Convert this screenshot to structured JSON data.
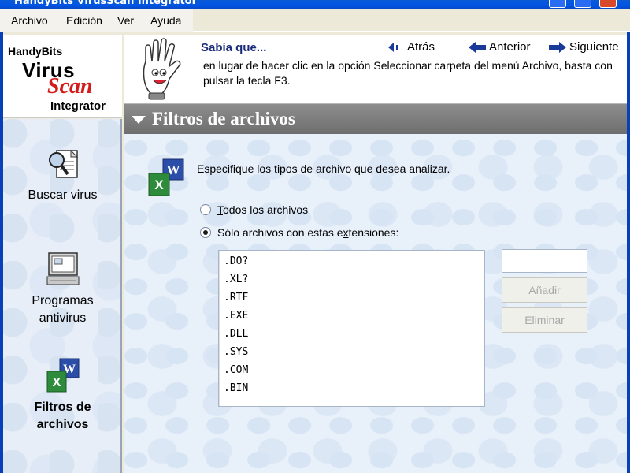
{
  "window": {
    "title": "HandyBits VirusScan Integrator"
  },
  "menu": [
    "Archivo",
    "Edición",
    "Ver",
    "Ayuda"
  ],
  "logo": {
    "line1": "HandyBits",
    "line2": "Virus",
    "line3": "Scan",
    "line4": "Integrator"
  },
  "sidebar": {
    "items": [
      {
        "label_lines": [
          "Buscar virus"
        ],
        "icon": "magnifier-document-icon",
        "active": false
      },
      {
        "label_lines": [
          "Programas",
          "antivirus"
        ],
        "icon": "computer-icon",
        "active": false
      },
      {
        "label_lines": [
          "Filtros de",
          "archivos"
        ],
        "icon": "word-excel-icon",
        "active": true
      }
    ]
  },
  "tip": {
    "heading": "Sabía que...",
    "text": "en lugar de hacer clic en la opción Seleccionar carpeta del menú Archivo, basta con pulsar la tecla F3.",
    "nav": {
      "back": "Atrás",
      "prev": "Anterior",
      "next": "Siguiente"
    }
  },
  "section": {
    "title": "Filtros de archivos"
  },
  "content": {
    "description": "Especifique los tipos de archivo que desea analizar.",
    "options": [
      {
        "label": "Todos los archivos",
        "mnemonic": "T",
        "checked": false
      },
      {
        "label": "Sólo archivos con estas extensiones:",
        "mnemonic": "x",
        "checked": true
      }
    ],
    "extensions": [
      ".DO?",
      ".XL?",
      ".RTF",
      ".EXE",
      ".DLL",
      ".SYS",
      ".COM",
      ".BIN"
    ],
    "input_value": "",
    "buttons": {
      "add": "Añadir",
      "remove": "Eliminar"
    }
  }
}
